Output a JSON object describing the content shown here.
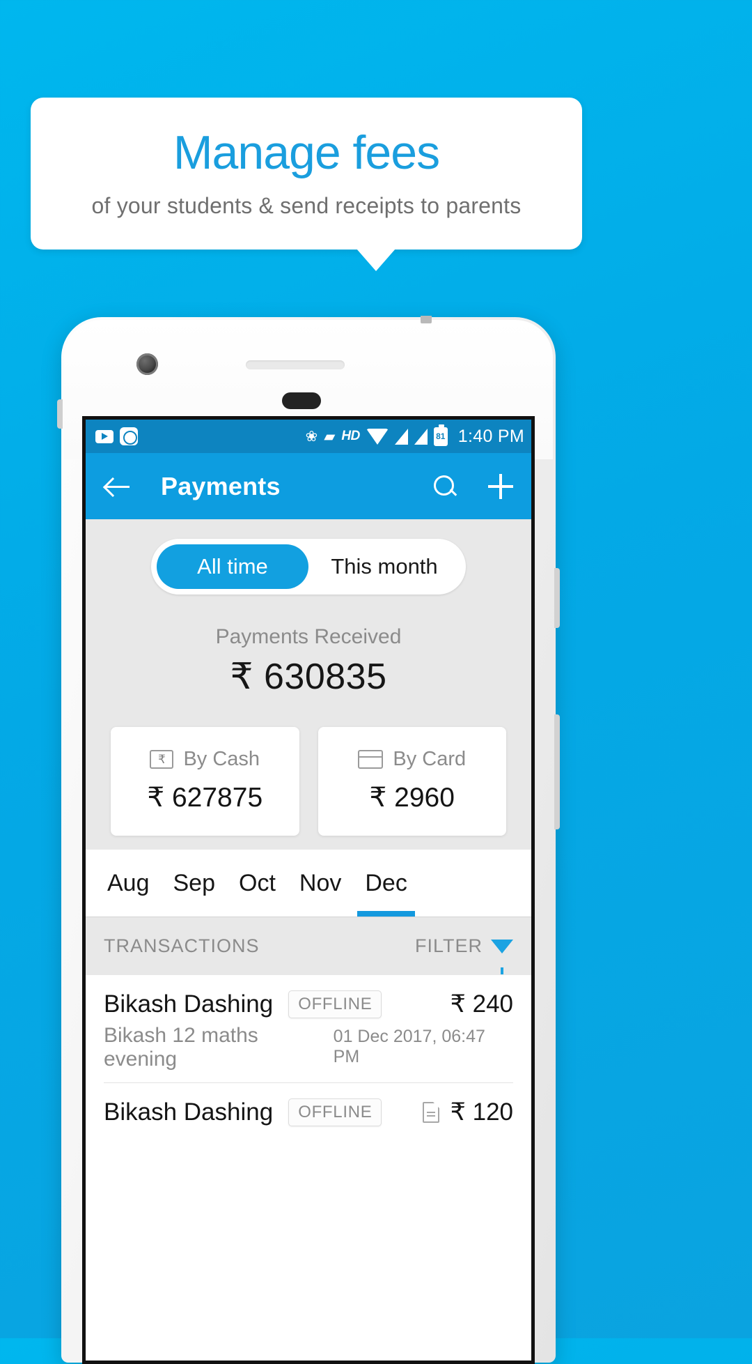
{
  "banner": {
    "title": "Manage fees",
    "subtitle": "of your students & send receipts to parents"
  },
  "statusbar": {
    "time": "1:40 PM",
    "battery_level": "81",
    "hd_label": "HD",
    "bluetooth_glyph": "ᛦ",
    "icons": [
      "youtube-icon",
      "camera-icon",
      "bluetooth-icon",
      "vibrate-icon",
      "hd-icon",
      "wifi-icon",
      "signal-icon-1",
      "signal-icon-2",
      "battery-icon"
    ]
  },
  "appbar": {
    "title": "Payments",
    "back_icon": "back-arrow-icon",
    "search_icon": "search-icon",
    "add_icon": "plus-icon"
  },
  "summary": {
    "segments": [
      {
        "label": "All time",
        "active": true
      },
      {
        "label": "This month",
        "active": false
      }
    ],
    "received_label": "Payments Received",
    "received_amount": "₹ 630835",
    "cards": [
      {
        "icon": "cash-icon",
        "label": "By Cash",
        "amount": "₹ 627875"
      },
      {
        "icon": "card-icon",
        "label": "By Card",
        "amount": "₹ 2960"
      }
    ]
  },
  "months": [
    {
      "label": "Aug",
      "active": false
    },
    {
      "label": "Sep",
      "active": false
    },
    {
      "label": "Oct",
      "active": false
    },
    {
      "label": "Nov",
      "active": false
    },
    {
      "label": "Dec",
      "active": true
    }
  ],
  "transactions_header": {
    "title": "TRANSACTIONS",
    "filter_label": "FILTER",
    "filter_icon": "funnel-icon"
  },
  "transactions": [
    {
      "name": "Bikash Dashing",
      "badge": "OFFLINE",
      "amount": "₹ 240",
      "description": "Bikash 12 maths evening",
      "date": "01 Dec 2017, 06:47 PM",
      "has_receipt": false
    },
    {
      "name": "Bikash Dashing",
      "badge": "OFFLINE",
      "amount": "₹ 120",
      "description": "",
      "date": "",
      "has_receipt": true
    }
  ],
  "colors": {
    "brand_blue": "#0d9de0",
    "background_blue": "#03a9e6",
    "statusbar_blue": "#0d84c0",
    "accent": "#12a0e0",
    "panel_gray": "#e8e8e8",
    "muted_text": "#8b8b8b"
  }
}
